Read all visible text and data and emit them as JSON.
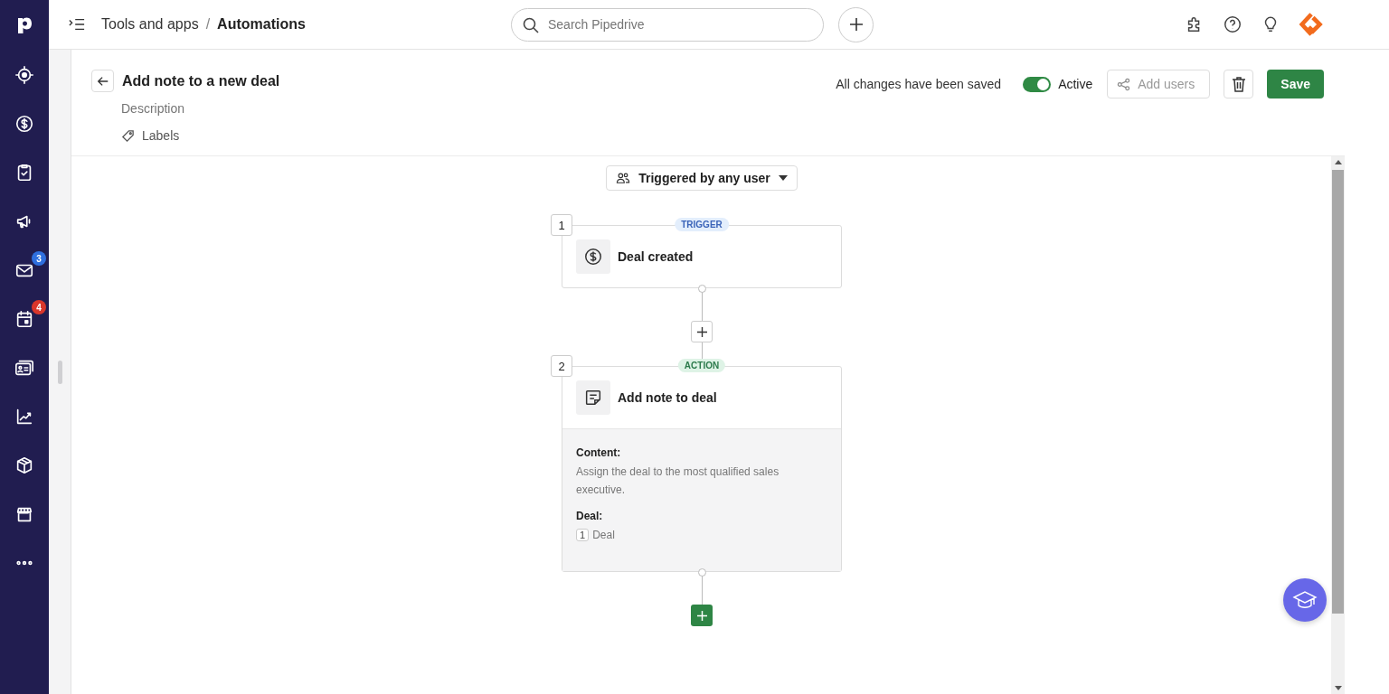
{
  "breadcrumb": {
    "parent": "Tools and apps",
    "separator": "/",
    "current": "Automations"
  },
  "search": {
    "placeholder": "Search Pipedrive"
  },
  "sidebar": {
    "items": [
      {
        "kind": "leads"
      },
      {
        "kind": "deals"
      },
      {
        "kind": "tasks"
      },
      {
        "kind": "campaigns"
      },
      {
        "kind": "mail",
        "badge": "3",
        "color": "#2f6fdf"
      },
      {
        "kind": "calendar",
        "badge": "4",
        "color": "#d9362b"
      },
      {
        "kind": "contacts"
      },
      {
        "kind": "insights"
      },
      {
        "kind": "products"
      },
      {
        "kind": "marketplace"
      },
      {
        "kind": "more"
      }
    ]
  },
  "automation": {
    "title": "Add note to a new deal",
    "description_placeholder": "Description",
    "labels": "Labels",
    "status": "All changes have been saved",
    "active": {
      "label": "Active",
      "on": true
    },
    "add_users": {
      "label": "Add users",
      "disabled": true
    },
    "save": "Save"
  },
  "trigger_filter": "Triggered by any user",
  "steps": [
    {
      "number": "1",
      "tag": "TRIGGER",
      "kind": "trigger",
      "title": "Deal created"
    },
    {
      "number": "2",
      "tag": "ACTION",
      "kind": "action",
      "title": "Add note to deal",
      "details": [
        {
          "label": "Content:",
          "value": "Assign the deal to the most qualified sales executive."
        },
        {
          "label": "Deal:",
          "ref": "1",
          "value": "Deal"
        }
      ]
    }
  ]
}
